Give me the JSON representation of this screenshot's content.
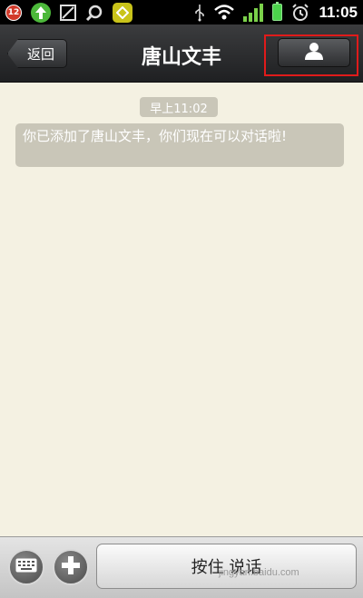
{
  "status_bar": {
    "notification_count": "12",
    "time": "11:05",
    "icons": [
      "notification-badge-icon",
      "upload-icon",
      "image-icon",
      "search-icon",
      "app-icon",
      "usb-icon",
      "wifi-icon",
      "signal-icon",
      "battery-icon",
      "alarm-icon"
    ]
  },
  "header": {
    "back_label": "返回",
    "title": "唐山文丰",
    "profile_icon": "person-icon"
  },
  "chat": {
    "timestamp": "早上11:02",
    "system_message": "你已添加了唐山文丰，你们现在可以对话啦!"
  },
  "input_bar": {
    "keyboard_icon": "keyboard-icon",
    "add_icon": "plus-icon",
    "hold_to_talk_label": "按住 说话"
  },
  "watermark": "jingyan.baidu.com",
  "colors": {
    "chat_background": "#f4f1e2",
    "bubble_gray": "#c9c6b8",
    "highlight_red": "#e01b1b"
  }
}
